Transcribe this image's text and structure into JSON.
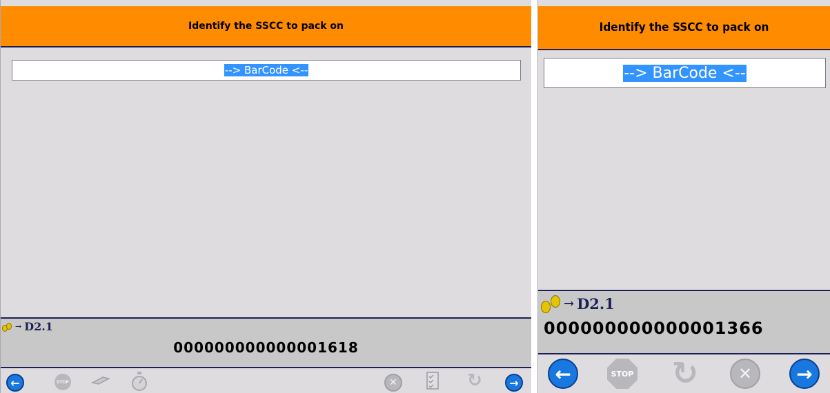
{
  "left": {
    "header_title": "Identify the SSCC to pack on",
    "barcode_value": "--> BarCode <--",
    "step_code": "D2.1",
    "sscc": "000000000000001618"
  },
  "right": {
    "header_title": "Identify the SSCC to pack on",
    "barcode_value": "--> BarCode <--",
    "step_code": "D2.1",
    "sscc": "000000000000001366"
  },
  "icons": {
    "back": "←",
    "next": "→",
    "stop": "STOP",
    "cancel": "✕",
    "refresh": "↻",
    "step_arrow": "→"
  },
  "colors": {
    "header": "#ff8c00",
    "border": "#1d1f57",
    "background": "#dfdce0",
    "selection": "#3494ff",
    "nav_button": "#1878e0"
  }
}
